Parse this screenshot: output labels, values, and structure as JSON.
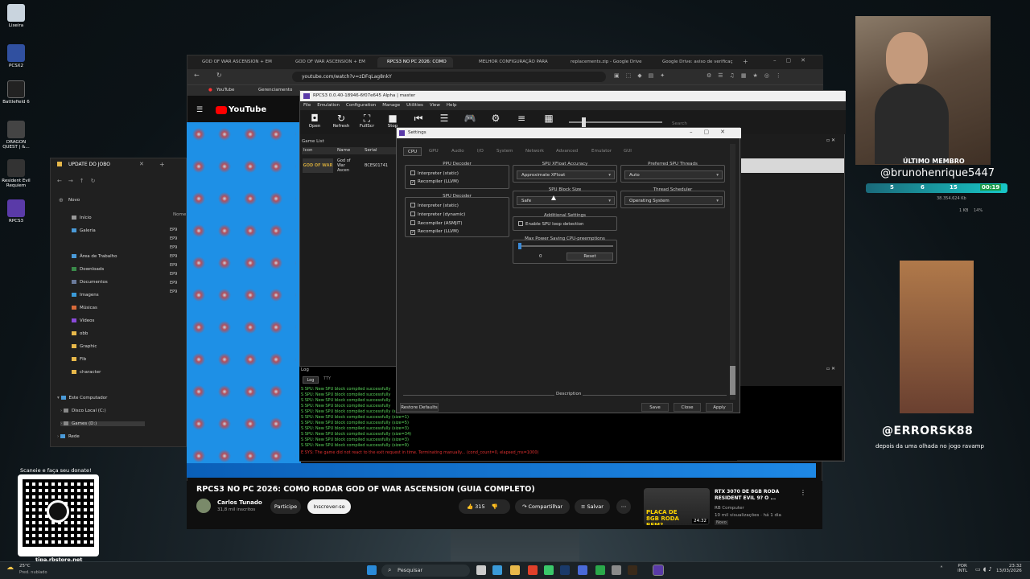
{
  "desktop": {
    "icons": [
      {
        "label": "Lixeira",
        "color": "#c9d4de"
      },
      {
        "label": "PCSX2",
        "color": "#3050a0"
      },
      {
        "label": "Battlefield 6",
        "color": "#222"
      },
      {
        "label": "DRAGON QUEST | &...",
        "color": "#444"
      },
      {
        "label": "Resident Evil Requiem",
        "color": "#333"
      },
      {
        "label": "RPCS3",
        "color": "#5a3aa8"
      }
    ]
  },
  "browser": {
    "tabs": [
      "GOD OF WAR ASCENSION + EM",
      "GOD OF WAR ASCENSION + EM",
      "RPCS3 NO PC 2026: COMO",
      "MELHOR CONFIGURAÇÃO PARA",
      "replacements.zip - Google Drive",
      "Google Drive: aviso de verificaç"
    ],
    "url": "youtube.com/watch?v=zDFqLag8nkY",
    "bookmarks": [
      "YouTube",
      "Gerenciamento"
    ],
    "yt_logo": "YouTube",
    "video_title": "RPCS3 NO PC 2026: COMO RODAR GOD OF WAR ASCENSION (GUIA COMPLETO)",
    "channel": "Carlos Tunado",
    "subs": "31,8 mil inscritos",
    "join": "Participe",
    "subscribe": "Inscrever-se",
    "likes": "315",
    "share": "Compartilhar",
    "save": "Salvar",
    "rec": {
      "title": "RTX 3070 DE 8GB RODA RESIDENT EVIL 9? O ...",
      "channel": "RB Computer",
      "meta": "10 mil visualizações · há 1 dia",
      "badge": "Novo",
      "duration": "24:32",
      "thumb_text": "PLACA DE 8GB RODA BEM?"
    }
  },
  "explorer": {
    "title": "UPDATE DO JOBO",
    "new": "Novo",
    "col": "Nome",
    "nav": [
      "Início",
      "Galeria",
      "Área de Trabalho",
      "Downloads",
      "Documentos",
      "Imagens",
      "Músicas",
      "Vídeos",
      "obb",
      "Graphic",
      "Flb",
      "character",
      "Este Computador",
      "Disco Local (C:)",
      "Games (D:)",
      "Rede"
    ],
    "files": [
      "EP9",
      "EP9",
      "EP9",
      "EP9",
      "EP9",
      "EP9",
      "EP9",
      "EP9"
    ]
  },
  "rpcs3": {
    "title": "RPCS3 0.0.40-18946-6f07e645 Alpha | master",
    "menu": [
      "File",
      "Emulation",
      "Configuration",
      "Manage",
      "Utilities",
      "View",
      "Help"
    ],
    "toolbar": [
      "Open",
      "Refresh",
      "FullScr",
      "Stop"
    ],
    "search": "Search",
    "gamelist": "Game List",
    "cols": [
      "Icon",
      "Name",
      "Serial"
    ],
    "game": {
      "name": "God of War Ascen",
      "serial": "BCES01741",
      "icon_text": "GOD OF WAR"
    },
    "log": {
      "title": "Log",
      "tabs": [
        "Log",
        "TTY"
      ],
      "lines": [
        "S SPU: New SPU block compiled successfully",
        "S SPU: New SPU block compiled successfully",
        "S SPU: New SPU block compiled successfully",
        "S SPU: New SPU block compiled successfully",
        "S SPU: New SPU block compiled successfully (size=7)",
        "S SPU: New SPU block compiled successfully (size=1)",
        "S SPU: New SPU block compiled successfully (size=5)",
        "S SPU: New SPU block compiled successfully (size=3)",
        "S SPU: New SPU block compiled successfully (size=34)",
        "S SPU: New SPU block compiled successfully (size=3)",
        "S SPU: New SPU block compiled successfully (size=9)"
      ],
      "error": "E SYS: The game did not react to the exit request in time. Terminating manually... (cond_count=0, elapsed_ms=1000)"
    }
  },
  "settings": {
    "title": "Settings",
    "tabs": [
      "CPU",
      "GPU",
      "Audio",
      "I/O",
      "System",
      "Network",
      "Advanced",
      "Emulator",
      "GUI"
    ],
    "ppu": {
      "title": "PPU Decoder",
      "opts": [
        {
          "label": "Interpreter (static)",
          "checked": false
        },
        {
          "label": "Recompiler (LLVM)",
          "checked": true
        }
      ]
    },
    "spu": {
      "title": "SPU Decoder",
      "opts": [
        {
          "label": "Interpreter (static)",
          "checked": false
        },
        {
          "label": "Interpreter (dynamic)",
          "checked": false
        },
        {
          "label": "Recompiler (ASMJIT)",
          "checked": false
        },
        {
          "label": "Recompiler (LLVM)",
          "checked": true
        }
      ]
    },
    "xfloat": {
      "title": "SPU XFloat Accuracy",
      "value": "Approximate XFloat"
    },
    "pspu": {
      "title": "Preferred SPU Threads",
      "value": "Auto"
    },
    "block": {
      "title": "SPU Block Size",
      "value": "Safe"
    },
    "sched": {
      "title": "Thread Scheduler",
      "value": "Operating System"
    },
    "additional": {
      "title": "Additional Settings",
      "opt": "Enable SPU loop detection"
    },
    "maxpower": {
      "title": "Max Power Saving CPU-preemptions",
      "value": "0",
      "reset": "Reset"
    },
    "description": "Description",
    "buttons": {
      "restore": "Restore Defaults",
      "save": "Save",
      "close": "Close",
      "apply": "Apply"
    }
  },
  "stream": {
    "member_label": "ÚLTIMO MEMBRO",
    "member": "@brunohenrique5447",
    "stats": [
      "5",
      "6",
      "15",
      "00:19"
    ],
    "errorsk": "@ERRORSK88",
    "caption": "depois da uma olhada no jogo ravamp",
    "qr_label": "Scaneie e faça seu donate!",
    "qr_url": "tipa.rbstore.net",
    "net": [
      "38.354.624 Kb",
      "1 KB",
      "14%"
    ]
  },
  "taskbar": {
    "search": "Pesquisar",
    "weather": "25°C",
    "weather_desc": "Pred. nublado",
    "lang": "POR",
    "lang2": "INTL",
    "time": "23:32",
    "date": "13/03/2026"
  }
}
